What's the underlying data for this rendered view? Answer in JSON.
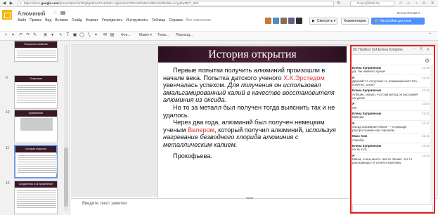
{
  "browser": {
    "url_prefix": "https://docs.",
    "url_domain": "google.com",
    "url_rest": "/presentation/d/1lrQ8g3ZmoiTzv6XaZc-slgaVnbUYGEHo8FMwzVl6liVr/edit#slide=id.g4be3577_025",
    "search_placeholder": "Поиск@Mail.Ru"
  },
  "app": {
    "doc_title": "Алюминий",
    "user_name": "Елена Рогова ▾",
    "menu": [
      "Файл",
      "Правка",
      "Вид",
      "Вставка",
      "Слайд",
      "Формат",
      "Упорядочить",
      "Инструменты",
      "Таблица",
      "Справка"
    ],
    "save_status": "Все изменения",
    "present_label": "Смотреть ▾",
    "comments_label": "Комментарии",
    "share_label": "Настройки доступа",
    "colors": {
      "share": "#4d90fe",
      "logo": "#f4b400",
      "slide_header": "#3a1828",
      "accent_red": "#e02020"
    }
  },
  "toolbar": {
    "zoom_label": "Фон...",
    "layout_label": "Макет ▾",
    "theme_label": "Тема...",
    "transition_label": "Переход..."
  },
  "filmstrip": {
    "slides": [
      {
        "num": "",
        "title": "Получение свойства"
      },
      {
        "num": "9",
        "title": "Получение"
      },
      {
        "num": "10",
        "title": "Применение"
      },
      {
        "num": "11",
        "title": "История открытия"
      },
      {
        "num": "12",
        "title": "Соединения и их применение"
      }
    ]
  },
  "slide": {
    "title": "История открытия",
    "p1_a": "Первые попытки получить алюминий произошли в начале века. Попытка датского ученого ",
    "p1_name": "Х.К.Эрстедом",
    "p1_b": " увенчалась успехом. ",
    "p1_italic": "Для получения он использовал амальгамированный калий в качестве восстановителя алюминия из оксида.",
    "p2": "Но то за металл был получен тогда выяснить так и не удалось.",
    "p3_a": "Через два года, алюминий был получен немецким ученым ",
    "p3_name": "Велером",
    "p3_b": ", который получил алюминий, ",
    "p3_italic": "используя нагревание безводного хлорида алюминия с металлическим калием.",
    "p4": "Прокофьева."
  },
  "notes": {
    "placeholder": "Введите текст заметки"
  },
  "chat": {
    "title": "(5) Hardkor Sof,Елена Куприян",
    "messages": [
      {
        "who": "Елена Куприянчик",
        "time": "21:39",
        "text": "да, так намного лучше"
      },
      {
        "who": "Я",
        "time": "21:40",
        "text": "Дерзай!!! А получают-то алюминий как? Кто - понятно, а как?"
      },
      {
        "who": "Елена Куприянчик",
        "time": "21:40",
        "text": "Алешик, сказал, что сам метод он расскажет на уроке"
      },
      {
        "who": "Я",
        "time": "21:40",
        "text": "ОК"
      },
      {
        "who": "Елена Куприянчик",
        "time": "21:41",
        "text": "Максим"
      },
      {
        "who": "Я",
        "time": "21:41",
        "text": "Оксид алюминия Al2O3 — в природе распространён как глинозём"
      },
      {
        "who": "Макс Ким",
        "time": "21:41",
        "text": "спасибо"
      },
      {
        "who": "Елена Куприянчик",
        "time": "21:42",
        "text": "не за что)"
      },
      {
        "who": "Я",
        "time": "21:43",
        "text": "Маша, очень много текста. Может что-то расскажешь? И хочется картинку"
      }
    ],
    "input_value": ""
  }
}
